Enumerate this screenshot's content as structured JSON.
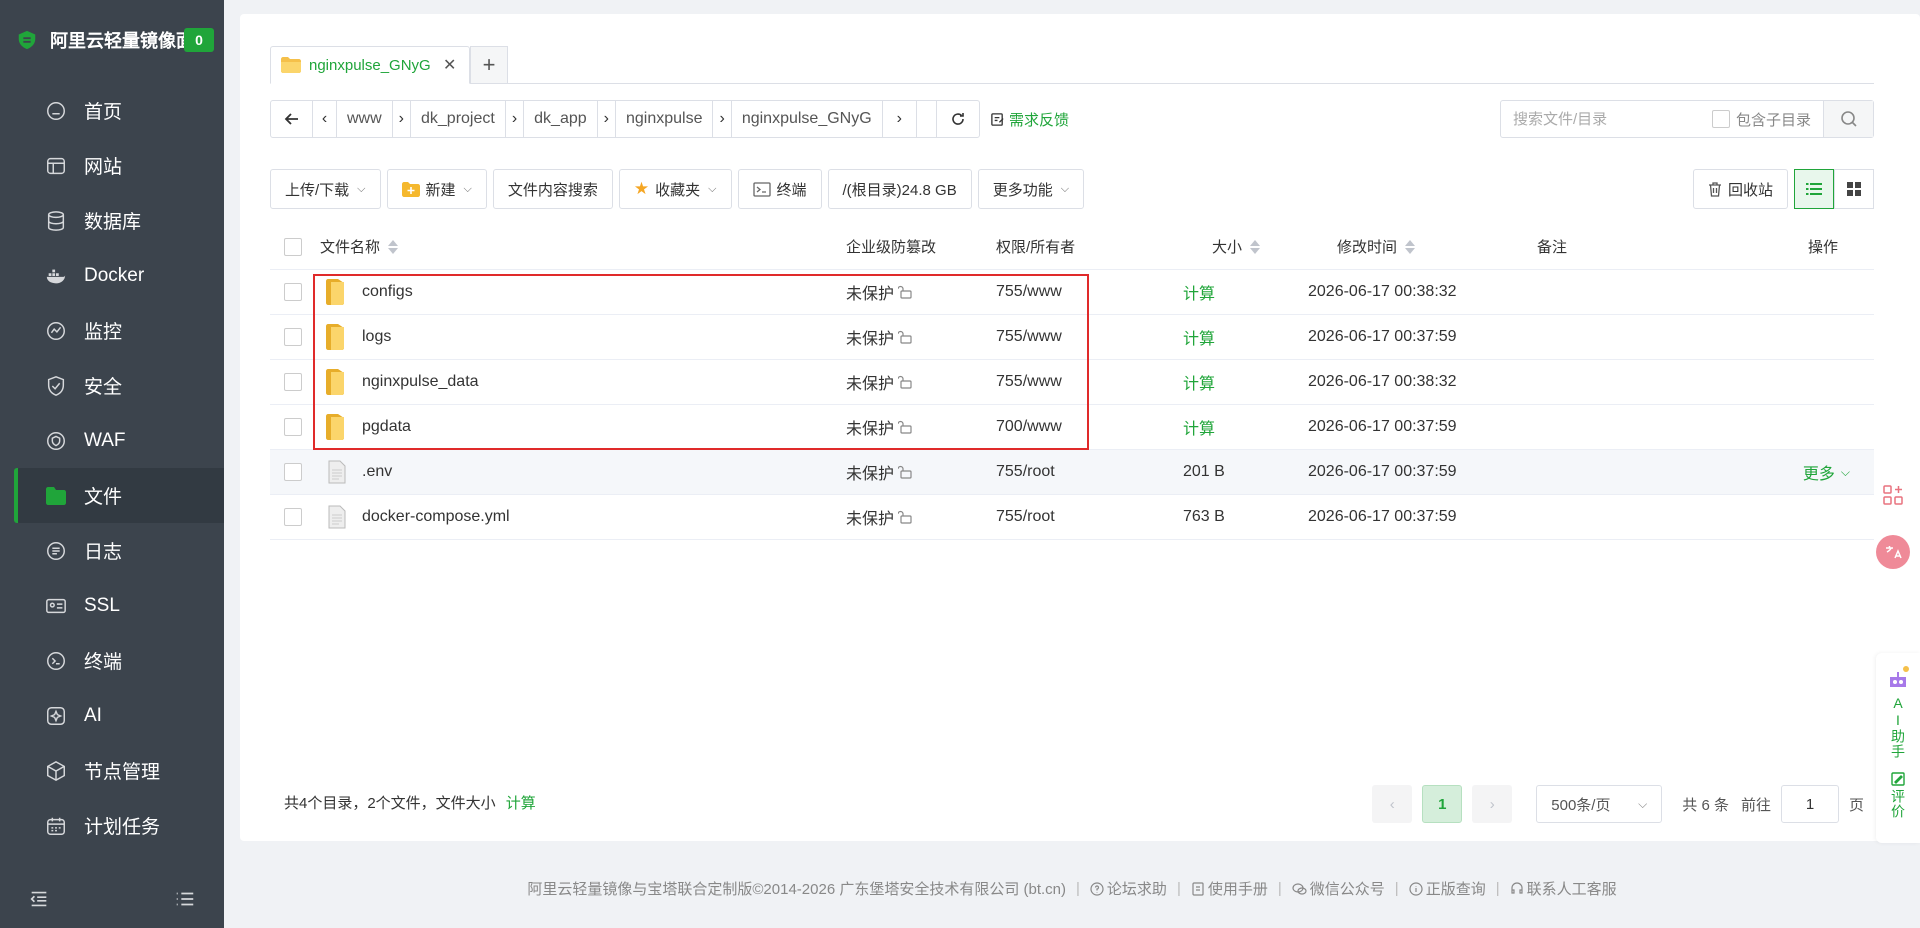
{
  "sidebar": {
    "title": "阿里云轻量镜像面板",
    "badge": "0",
    "items": [
      {
        "label": "首页",
        "icon": "home-icon"
      },
      {
        "label": "网站",
        "icon": "website-icon"
      },
      {
        "label": "数据库",
        "icon": "database-icon"
      },
      {
        "label": "Docker",
        "icon": "docker-icon"
      },
      {
        "label": "监控",
        "icon": "monitor-icon"
      },
      {
        "label": "安全",
        "icon": "shield-icon"
      },
      {
        "label": "WAF",
        "icon": "waf-icon"
      },
      {
        "label": "文件",
        "icon": "folder-icon",
        "active": true
      },
      {
        "label": "日志",
        "icon": "log-icon"
      },
      {
        "label": "SSL",
        "icon": "ssl-icon"
      },
      {
        "label": "终端",
        "icon": "terminal-icon"
      },
      {
        "label": "AI",
        "icon": "ai-icon"
      },
      {
        "label": "节点管理",
        "icon": "node-icon"
      },
      {
        "label": "计划任务",
        "icon": "calendar-icon"
      }
    ]
  },
  "tabs": [
    {
      "label": "nginxpulse_GNyG"
    }
  ],
  "path": {
    "crumbs": [
      "www",
      "dk_project",
      "dk_app",
      "nginxpulse",
      "nginxpulse_GNyG"
    ],
    "feedback": "需求反馈"
  },
  "search": {
    "placeholder": "搜索文件/目录",
    "include_subdir": "包含子目录"
  },
  "toolbar": {
    "upload": "上传/下载",
    "new": "新建",
    "content_search": "文件内容搜索",
    "favorites": "收藏夹",
    "terminal": "终端",
    "disk": "/(根目录)24.8 GB",
    "more": "更多功能",
    "recycle": "回收站"
  },
  "table": {
    "headers": {
      "name": "文件名称",
      "protect": "企业级防篡改",
      "perm": "权限/所有者",
      "size": "大小",
      "mtime": "修改时间",
      "note": "备注",
      "ops": "操作"
    },
    "rows": [
      {
        "name": "configs",
        "type": "folder",
        "protect": "未保护",
        "perm": "755/www",
        "size": "计算",
        "mtime": "2026-06-17 00:38:32"
      },
      {
        "name": "logs",
        "type": "folder",
        "protect": "未保护",
        "perm": "755/www",
        "size": "计算",
        "mtime": "2026-06-17 00:37:59"
      },
      {
        "name": "nginxpulse_data",
        "type": "folder",
        "protect": "未保护",
        "perm": "755/www",
        "size": "计算",
        "mtime": "2026-06-17 00:38:32"
      },
      {
        "name": "pgdata",
        "type": "folder",
        "protect": "未保护",
        "perm": "700/www",
        "size": "计算",
        "mtime": "2026-06-17 00:37:59"
      },
      {
        "name": ".env",
        "type": "file",
        "protect": "未保护",
        "perm": "755/root",
        "size": "201 B",
        "mtime": "2026-06-17 00:37:59",
        "ops": "更多"
      },
      {
        "name": "docker-compose.yml",
        "type": "file",
        "protect": "未保护",
        "perm": "755/root",
        "size": "763 B",
        "mtime": "2026-06-17 00:37:59"
      }
    ]
  },
  "summary": {
    "text": "共4个目录，2个文件，文件大小",
    "calc": "计算"
  },
  "pager": {
    "current": "1",
    "page_size": "500条/页",
    "total": "共 6 条",
    "goto": "前往",
    "goto_value": "1",
    "page_unit": "页"
  },
  "footer": {
    "copyright": "阿里云轻量镜像与宝塔联合定制版©2014-2026 广东堡塔安全技术有限公司 (bt.cn)",
    "links": [
      "论坛求助",
      "使用手册",
      "微信公众号",
      "正版查询",
      "联系人工客服"
    ]
  },
  "ai_panel": {
    "assistant": "AI助手",
    "rate": "评价"
  },
  "colors": {
    "accent": "#20a53a",
    "sidebar_bg": "#3c444d",
    "highlight": "#e02a2a"
  }
}
